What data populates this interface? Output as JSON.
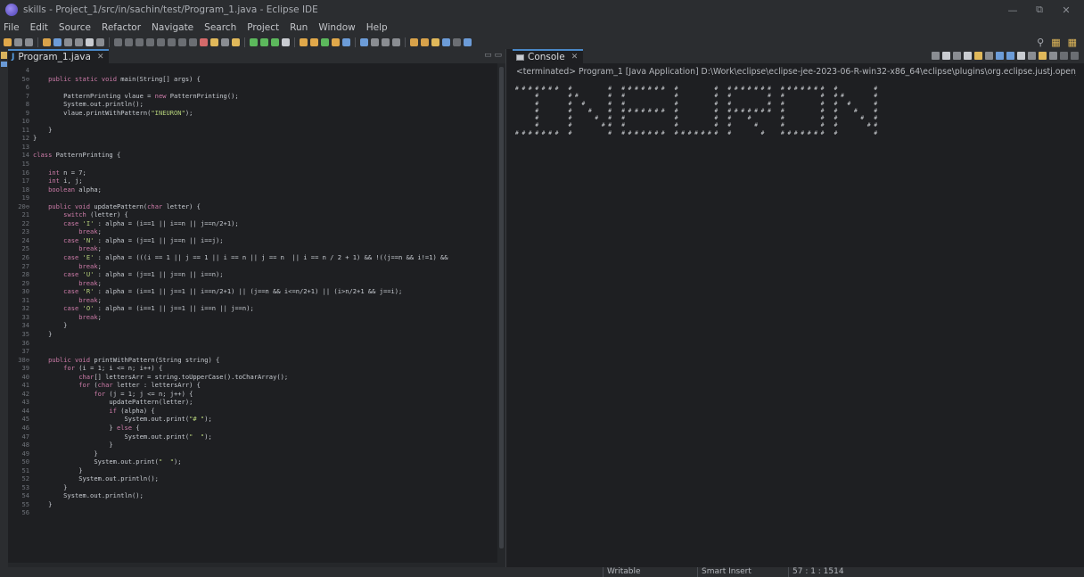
{
  "window": {
    "title": "skills - Project_1/src/in/sachin/test/Program_1.java - Eclipse IDE",
    "minimize": "—",
    "maximize": "⧉",
    "close": "✕"
  },
  "menu": [
    "File",
    "Edit",
    "Source",
    "Refactor",
    "Navigate",
    "Search",
    "Project",
    "Run",
    "Window",
    "Help"
  ],
  "toolbar_right": {
    "search_icon": "search-icon",
    "search": "⚲",
    "perspective_1": "▦",
    "perspective_2": "▦"
  },
  "editor": {
    "tab_icon": "J",
    "tab_label": "Program_1.java",
    "tab_close": "✕",
    "min_max": "▭ ▭",
    "lines": [
      {
        "n": "4",
        "code": ""
      },
      {
        "n": "5⊖",
        "code": "    public static void main(String[] args) {"
      },
      {
        "n": "6",
        "code": ""
      },
      {
        "n": "7",
        "code": "        PatternPrinting vlaue = new PatternPrinting();"
      },
      {
        "n": "8",
        "code": "        System.out.println();"
      },
      {
        "n": "9",
        "code": "        vlaue.printWithPattern(\"INEURON\");"
      },
      {
        "n": "10",
        "code": ""
      },
      {
        "n": "11",
        "code": "    }"
      },
      {
        "n": "12",
        "code": "}"
      },
      {
        "n": "13",
        "code": ""
      },
      {
        "n": "14",
        "code": "class PatternPrinting {"
      },
      {
        "n": "15",
        "code": ""
      },
      {
        "n": "16",
        "code": "    int n = 7;"
      },
      {
        "n": "17",
        "code": "    int i, j;"
      },
      {
        "n": "18",
        "code": "    boolean alpha;"
      },
      {
        "n": "19",
        "code": ""
      },
      {
        "n": "20⊖",
        "code": "    public void updatePattern(char letter) {"
      },
      {
        "n": "21",
        "code": "        switch (letter) {"
      },
      {
        "n": "22",
        "code": "        case 'I' : alpha = (i==1 || i==n || j==n/2+1);"
      },
      {
        "n": "23",
        "code": "            break;"
      },
      {
        "n": "24",
        "code": "        case 'N' : alpha = (j==1 || j==n || i==j);"
      },
      {
        "n": "25",
        "code": "            break;"
      },
      {
        "n": "26",
        "code": "        case 'E' : alpha = (((i == 1 || j == 1 || i == n || j == n  || i == n / 2 + 1) && !((j==n && i!=1) &&"
      },
      {
        "n": "27",
        "code": "            break;"
      },
      {
        "n": "28",
        "code": "        case 'U' : alpha = (j==1 || j==n || i==n);"
      },
      {
        "n": "29",
        "code": "            break;"
      },
      {
        "n": "30",
        "code": "        case 'R' : alpha = (i==1 || j==1 || i==n/2+1) || (j==n && i<=n/2+1) || (i>n/2+1 && j==i);"
      },
      {
        "n": "31",
        "code": "            break;"
      },
      {
        "n": "32",
        "code": "        case 'O' : alpha = (i==1 || j==1 || i==n || j==n);"
      },
      {
        "n": "33",
        "code": "            break;"
      },
      {
        "n": "34",
        "code": "        }"
      },
      {
        "n": "35",
        "code": "    }"
      },
      {
        "n": "36",
        "code": ""
      },
      {
        "n": "37",
        "code": ""
      },
      {
        "n": "38⊖",
        "code": "    public void printWithPattern(String string) {"
      },
      {
        "n": "39",
        "code": "        for (i = 1; i <= n; i++) {"
      },
      {
        "n": "40",
        "code": "            char[] lettersArr = string.toUpperCase().toCharArray();"
      },
      {
        "n": "41",
        "code": "            for (char letter : lettersArr) {"
      },
      {
        "n": "42",
        "code": "                for (j = 1; j <= n; j++) {"
      },
      {
        "n": "43",
        "code": "                    updatePattern(letter);"
      },
      {
        "n": "44",
        "code": "                    if (alpha) {"
      },
      {
        "n": "45",
        "code": "                        System.out.print(\"# \");"
      },
      {
        "n": "46",
        "code": "                    } else {"
      },
      {
        "n": "47",
        "code": "                        System.out.print(\"  \");"
      },
      {
        "n": "48",
        "code": "                    }"
      },
      {
        "n": "49",
        "code": "                }"
      },
      {
        "n": "50",
        "code": "                System.out.print(\"  \");"
      },
      {
        "n": "51",
        "code": "            }"
      },
      {
        "n": "52",
        "code": "            System.out.println();"
      },
      {
        "n": "53",
        "code": "        }"
      },
      {
        "n": "54",
        "code": "        System.out.println();"
      },
      {
        "n": "55",
        "code": "    }"
      },
      {
        "n": "56",
        "code": ""
      }
    ]
  },
  "console": {
    "tab_label": "Console",
    "tab_close": "✕",
    "terminated": "<terminated> Program_1 [Java Application] D:\\Work\\eclipse\\eclipse-jee-2023-06-R-win32-x86_64\\eclipse\\plugins\\org.eclipse.justj.openjdk.hotspot.jre",
    "output": [
      "# # # # # # #   #           #   # # # # # # #   #           #   # # # # # # #   # # # # # # #   #           #",
      "      #         # #         #   #               #           #   #           #   #           #   # #         #",
      "      #         #   #       #   #               #           #   #           #   #           #   #   #       #",
      "      #         #     #     #   # # # # # # #   #           #   # # # # # # #   #           #   #     #     #",
      "      #         #       #   #   #               #           #   #     #         #           #   #       #   #",
      "      #         #         # #   #               #           #   #       #       #           #   #         # #",
      "# # # # # # #   #           #   # # # # # # #   # # # # # # #   #         #     # # # # # # #   #           #"
    ]
  },
  "status": {
    "mode": "Writable",
    "insert": "Smart Insert",
    "position": "57 : 1 : 1514"
  },
  "colors": {
    "keyword": "#cc7ba8",
    "string": "#b5d17a",
    "number": "#9bb7e0",
    "accent": "#4a88c7"
  }
}
